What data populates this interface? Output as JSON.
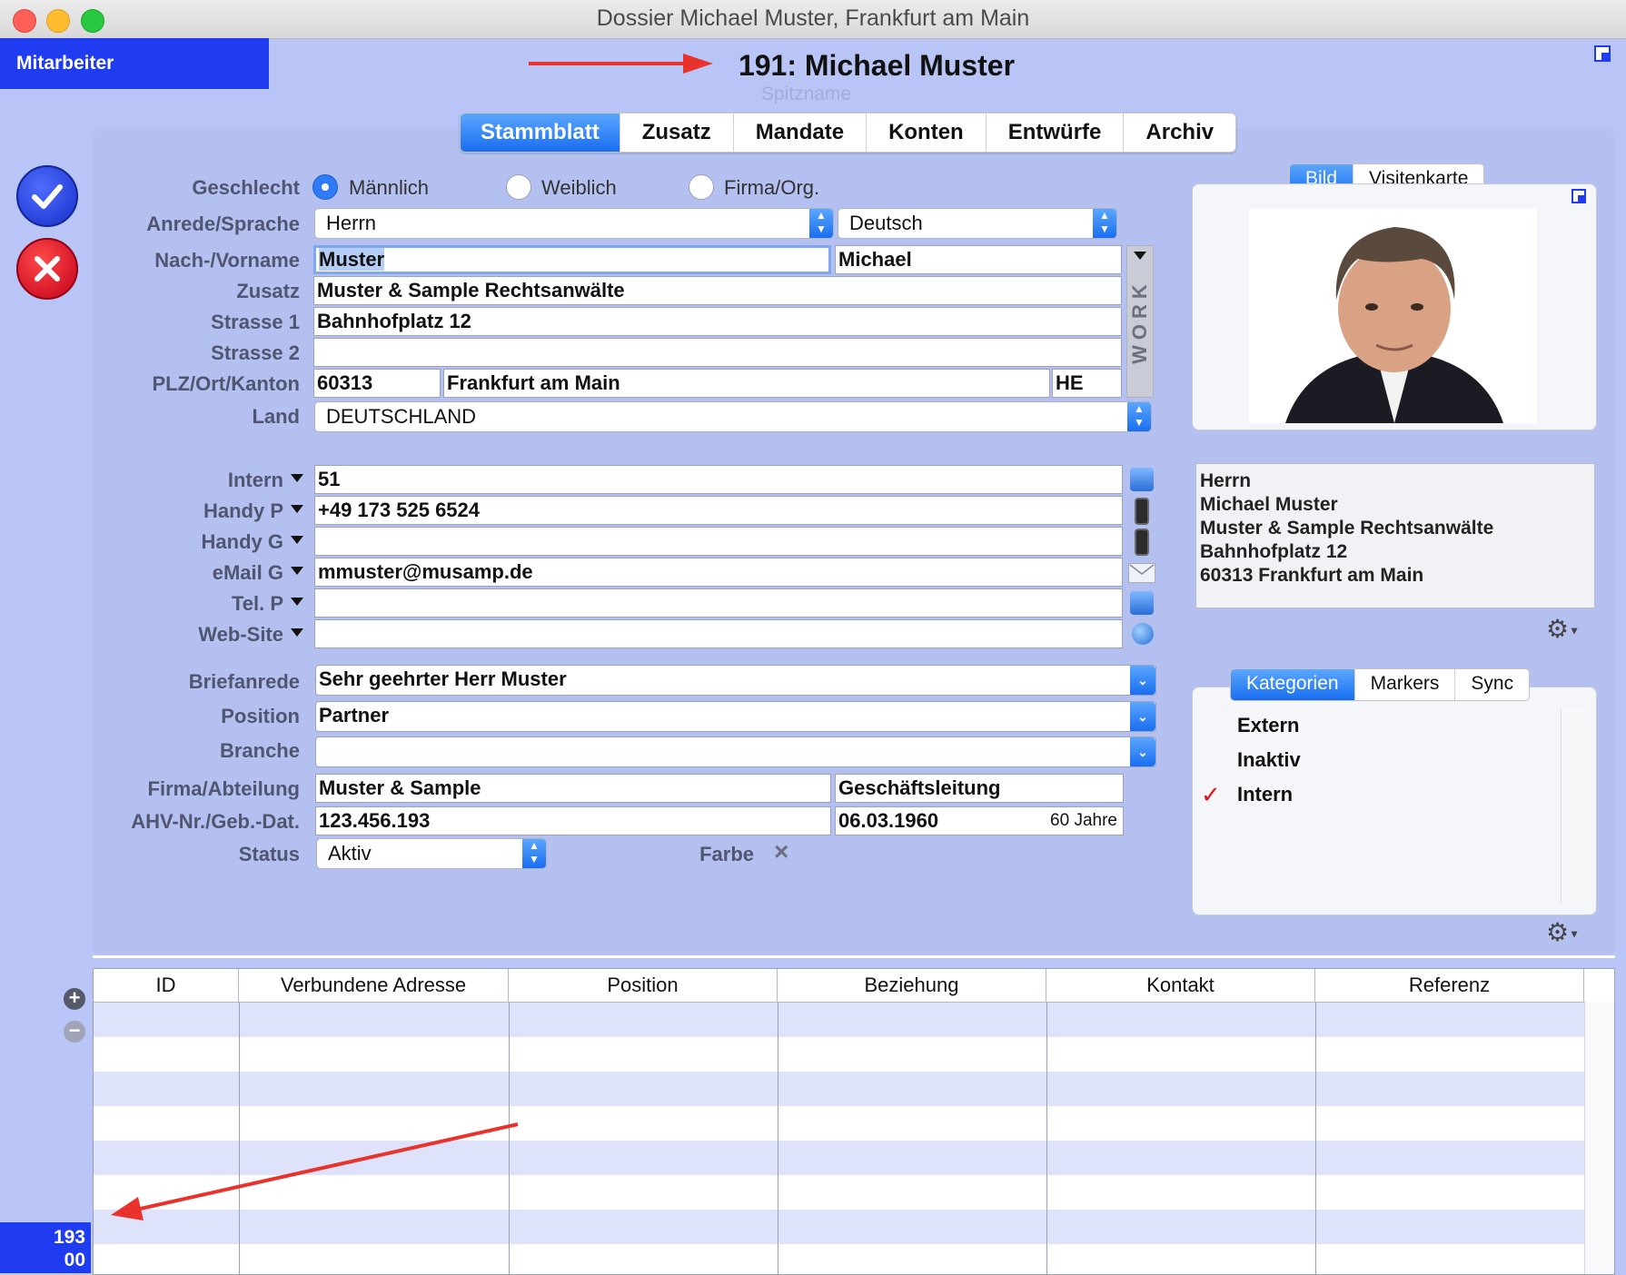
{
  "window": {
    "title": "Dossier Michael Muster, Frankfurt am Main"
  },
  "mode_button": "Mitarbeiter",
  "record": {
    "heading": "191: Michael Muster",
    "nickname_placeholder": "Spitzname"
  },
  "tabs": [
    "Stammblatt",
    "Zusatz",
    "Mandate",
    "Konten",
    "Entwürfe",
    "Archiv"
  ],
  "form": {
    "labels": {
      "geschlecht": "Geschlecht",
      "anrede": "Anrede/Sprache",
      "name": "Nach-/Vorname",
      "zusatz": "Zusatz",
      "strasse1": "Strasse 1",
      "strasse2": "Strasse 2",
      "plz": "PLZ/Ort/Kanton",
      "land": "Land",
      "briefanrede": "Briefanrede",
      "position": "Position",
      "branche": "Branche",
      "firma": "Firma/Abteilung",
      "ahv": "AHV-Nr./Geb.-Dat.",
      "status": "Status",
      "farbe": "Farbe"
    },
    "gender_options": [
      "Männlich",
      "Weiblich",
      "Firma/Org."
    ],
    "anrede": "Herrn",
    "sprache": "Deutsch",
    "nachname": "Muster",
    "vorname": "Michael",
    "zusatz": "Muster & Sample Rechtsanwälte",
    "strasse1": "Bahnhofplatz 12",
    "strasse2": "",
    "plz": "60313",
    "ort": "Frankfurt am Main",
    "kanton": "HE",
    "land": "DEUTSCHLAND",
    "work_tab": "WORK",
    "briefanrede": "Sehr geehrter Herr Muster",
    "position": "Partner",
    "branche": "",
    "firma": "Muster & Sample",
    "abteilung": "Geschäftsleitung",
    "ahv": "123.456.193",
    "geburtsdatum": "06.03.1960",
    "alter": "60 Jahre",
    "status": "Aktiv",
    "farbe_clear": "×"
  },
  "contacts": [
    {
      "label": "Intern",
      "value": "51",
      "icon": "phone-icon"
    },
    {
      "label": "Handy P",
      "value": "+49 173 525 6524",
      "icon": "mobile-icon"
    },
    {
      "label": "Handy G",
      "value": "",
      "icon": "mobile-icon"
    },
    {
      "label": "eMail G",
      "value": "mmuster@musamp.de",
      "icon": "mail-icon"
    },
    {
      "label": "Tel. P",
      "value": "",
      "icon": "phone-icon"
    },
    {
      "label": "Web-Site",
      "value": "",
      "icon": "globe-icon"
    }
  ],
  "photo_tabs": [
    "Bild",
    "Visitenkarte"
  ],
  "address_block": [
    "Herrn",
    "Michael Muster",
    "Muster & Sample Rechtsanwälte",
    "Bahnhofplatz 12",
    "60313 Frankfurt am Main"
  ],
  "category_tabs": [
    "Kategorien",
    "Markers",
    "Sync"
  ],
  "categories": [
    {
      "name": "Extern",
      "checked": false
    },
    {
      "name": "Inaktiv",
      "checked": false
    },
    {
      "name": "Intern",
      "checked": true
    }
  ],
  "table": {
    "columns": [
      "ID",
      "Verbundene Adresse",
      "Position",
      "Beziehung",
      "Kontakt",
      "Referenz"
    ]
  },
  "counter": [
    "193",
    "00"
  ],
  "colors": {
    "accent": "#1f3cf0",
    "background": "#b9c4f7",
    "tab_active": "#1a6ef0",
    "annotation_arrow": "#e8322b"
  }
}
